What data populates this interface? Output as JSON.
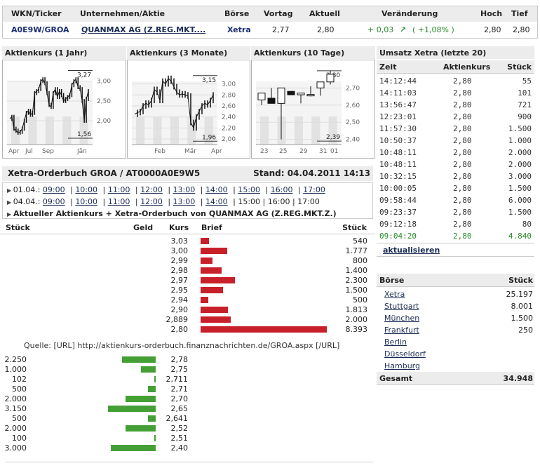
{
  "quote": {
    "headers": [
      "WKN/Ticker",
      "Unternehmen/Aktie",
      "Börse",
      "Vortag",
      "Aktuell",
      "Veränderung",
      "Hoch",
      "Tief"
    ],
    "ticker": "A0E9W/GROA",
    "company": "QUANMAX AG (Z.REG.MKT....",
    "exchange": "Xetra",
    "prev": "2,77",
    "current": "2,80",
    "change": "+ 0,03",
    "change_icon": "arrow-up-right-icon",
    "change_pct": "( +1,08% )",
    "high": "2,80",
    "low": "2,80",
    "up_color": "#2a8a2a"
  },
  "charts": [
    {
      "title": "Aktienkurs (1 Jahr)",
      "ylim": [
        1.4,
        3.35
      ],
      "yticks": [
        {
          "v": 3.0,
          "label": "3,00"
        },
        {
          "v": 2.5,
          "label": "2,50"
        },
        {
          "v": 2.0,
          "label": "2,00"
        }
      ],
      "hi": "3,27",
      "lo": "1,56",
      "hi_v": 3.27,
      "lo_v": 1.56,
      "xlabels": [
        "Apr",
        "Jul",
        "Sep",
        "Jän"
      ],
      "closes": [
        2.05,
        2.1,
        1.8,
        1.75,
        1.7,
        1.72,
        1.8,
        2.0,
        2.2,
        2.25,
        2.15,
        2.2,
        2.7,
        2.75,
        2.8,
        3.0,
        3.05,
        2.95,
        2.7,
        2.4,
        2.35,
        2.7,
        2.8,
        2.6,
        2.75,
        2.65,
        2.5,
        2.55,
        2.6,
        2.65,
        2.9,
        3.0,
        3.05,
        2.85,
        2.8,
        2.5,
        2.0,
        2.55,
        2.75
      ]
    },
    {
      "title": "Aktienkurs (3 Monate)",
      "ylim": [
        1.9,
        3.3
      ],
      "yticks": [
        {
          "v": 3.0,
          "label": "3,00"
        },
        {
          "v": 2.8,
          "label": "2,80"
        },
        {
          "v": 2.6,
          "label": "2,60"
        },
        {
          "v": 2.4,
          "label": "2,40"
        },
        {
          "v": 2.2,
          "label": "2,20"
        },
        {
          "v": 2.0,
          "label": "2,00"
        }
      ],
      "hi": "3,15",
      "lo": "1,96",
      "hi_v": 3.15,
      "lo_v": 1.96,
      "xlabels": [
        "Feb",
        "Mär",
        "Apr"
      ],
      "closes": [
        2.45,
        2.48,
        2.5,
        2.6,
        2.65,
        2.62,
        2.7,
        2.9,
        2.85,
        2.7,
        3.05,
        3.0,
        3.1,
        3.05,
        2.95,
        2.85,
        2.8,
        2.82,
        2.8,
        2.78,
        2.3,
        2.2,
        2.4,
        2.5,
        2.6,
        2.65,
        2.62,
        2.7,
        2.8
      ]
    },
    {
      "title": "Aktienkurs (10 Tage)",
      "ylim": [
        2.37,
        2.82
      ],
      "yticks": [
        {
          "v": 2.7,
          "label": "2,70"
        },
        {
          "v": 2.6,
          "label": "2,60"
        },
        {
          "v": 2.5,
          "label": "2,50"
        },
        {
          "v": 2.4,
          "label": "2,40"
        }
      ],
      "hi": "2,80",
      "lo": "2,39",
      "hi_v": 2.8,
      "lo_v": 2.39,
      "xlabels": [
        "23",
        "25",
        "29",
        "31",
        "01"
      ],
      "candles": [
        {
          "o": 2.63,
          "h": 2.67,
          "l": 2.6,
          "c": 2.67
        },
        {
          "o": 2.64,
          "h": 2.7,
          "l": 2.61,
          "c": 2.61
        },
        {
          "o": 2.61,
          "h": 2.7,
          "l": 2.4,
          "c": 2.7
        },
        {
          "o": 2.68,
          "h": 2.68,
          "l": 2.66,
          "c": 2.66
        },
        {
          "o": 2.66,
          "h": 2.67,
          "l": 2.61,
          "c": 2.67
        },
        {
          "o": 2.66,
          "h": 2.71,
          "l": 2.65,
          "c": 2.662
        },
        {
          "o": 2.7,
          "h": 2.735,
          "l": 2.655,
          "c": 2.735
        },
        {
          "o": 2.735,
          "h": 2.8,
          "l": 2.72,
          "c": 2.78
        }
      ]
    }
  ],
  "trades": {
    "title": "Umsatz Xetra (letzte 20)",
    "headers": [
      "Zeit",
      "Aktienkurs",
      "Stück"
    ],
    "rows": [
      [
        "14:12:44",
        "2,80",
        "55"
      ],
      [
        "14:11:03",
        "2,80",
        "101"
      ],
      [
        "13:56:47",
        "2,80",
        "721"
      ],
      [
        "12:23:01",
        "2,80",
        "900"
      ],
      [
        "11:57:30",
        "2,80",
        "1.500"
      ],
      [
        "10:50:37",
        "2,80",
        "1.000"
      ],
      [
        "10:48:11",
        "2,80",
        "2.000"
      ],
      [
        "10:48:11",
        "2,80",
        "2.000"
      ],
      [
        "10:32:15",
        "2,80",
        "3.000"
      ],
      [
        "10:00:05",
        "2,80",
        "1.500"
      ],
      [
        "09:58:44",
        "2,80",
        "6.000"
      ],
      [
        "09:23:37",
        "2,80",
        "1.500"
      ],
      [
        "09:12:18",
        "2,80",
        "80"
      ],
      [
        "09:04:20",
        "2,80",
        "4.840"
      ]
    ],
    "refresh": "aktualisieren"
  },
  "orderbook": {
    "title": "Xetra-Orderbuch GROA / AT0000A0E9W5",
    "stand": "Stand: 04.04.2011 14:13",
    "days": [
      {
        "label": "01.04.:",
        "times": [
          "09:00",
          "10:00",
          "11:00",
          "12:00",
          "13:00",
          "14:00",
          "15:00",
          "16:00",
          "17:00"
        ],
        "linked": 9
      },
      {
        "label": "04.04.:",
        "times": [
          "09:00",
          "10:00",
          "11:00",
          "12:00",
          "13:00",
          "14:00",
          "15:00",
          "16:00",
          "17:00"
        ],
        "linked": 6
      }
    ],
    "current_link": "Aktueller Aktienkurs + Xetra-Orderbuch von QUANMAX AG (Z.REG.MKT.Z.)",
    "headers": {
      "stueck_l": "Stück",
      "geld": "Geld",
      "kurs": "Kurs",
      "brief": "Brief",
      "stueck_r": "Stück"
    },
    "ask": [
      {
        "kurs": "3,03",
        "qty": "540",
        "v": 540
      },
      {
        "kurs": "3,00",
        "qty": "1.777",
        "v": 1777
      },
      {
        "kurs": "2,99",
        "qty": "800",
        "v": 800
      },
      {
        "kurs": "2,98",
        "qty": "1.400",
        "v": 1400
      },
      {
        "kurs": "2,97",
        "qty": "2.300",
        "v": 2300
      },
      {
        "kurs": "2,95",
        "qty": "1.500",
        "v": 1500
      },
      {
        "kurs": "2,94",
        "qty": "500",
        "v": 500
      },
      {
        "kurs": "2,90",
        "qty": "1.813",
        "v": 1813
      },
      {
        "kurs": "2,889",
        "qty": "2.000",
        "v": 2000
      },
      {
        "kurs": "2,80",
        "qty": "8.393",
        "v": 8393
      }
    ],
    "source": "Quelle: [URL] http://aktienkurs-orderbuch.finanznachrichten.de/GROA.aspx [/URL]",
    "bid": [
      {
        "kurs": "2,78",
        "qty": "2.250",
        "v": 2250
      },
      {
        "kurs": "2,75",
        "qty": "1.000",
        "v": 1000
      },
      {
        "kurs": "2,711",
        "qty": "102",
        "v": 102
      },
      {
        "kurs": "2,71",
        "qty": "500",
        "v": 500
      },
      {
        "kurs": "2,70",
        "qty": "2.000",
        "v": 2000
      },
      {
        "kurs": "2,65",
        "qty": "3.150",
        "v": 3150
      },
      {
        "kurs": "2,641",
        "qty": "500",
        "v": 500
      },
      {
        "kurs": "2,52",
        "qty": "2.000",
        "v": 2000
      },
      {
        "kurs": "2,51",
        "qty": "100",
        "v": 100
      },
      {
        "kurs": "2,40",
        "qty": "3.000",
        "v": 3000
      }
    ],
    "ask_color": "#c8202a",
    "bid_color": "#44a035"
  },
  "exchanges": {
    "headers": [
      "Börse",
      "Stück"
    ],
    "rows": [
      [
        "Xetra",
        "25.197"
      ],
      [
        "Stuttgart",
        "8.001"
      ],
      [
        "München",
        "1.500"
      ],
      [
        "Frankfurt",
        "250"
      ],
      [
        "Berlin",
        ""
      ],
      [
        "Düsseldorf",
        ""
      ],
      [
        "Hamburg",
        ""
      ]
    ],
    "total_label": "Gesamt",
    "total": "34.948"
  }
}
